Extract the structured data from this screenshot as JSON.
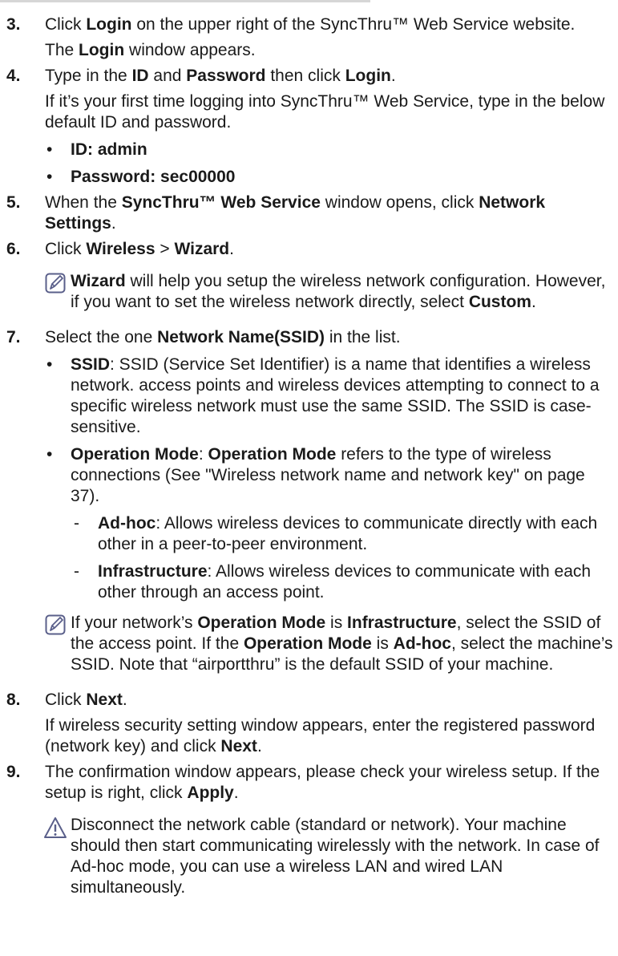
{
  "steps": [
    {
      "num": "3.",
      "t1": "Click ",
      "b1": "Login",
      "t2": " on the upper right of the SyncThru™ Web Service website.",
      "sub": {
        "b": "Login",
        "t": " window appears.",
        "pre": "The "
      }
    },
    {
      "num": "4.",
      "t1": "Type in the ",
      "b1": "ID",
      "t2": " and ",
      "b2": "Password",
      "t3": " then click ",
      "b3": "Login",
      "t4": ".",
      "p": "If it’s your first time logging into SyncThru™ Web Service, type in the below default ID and password.",
      "bullets": [
        "ID:  admin",
        "Password:  sec00000"
      ]
    },
    {
      "num": "5.",
      "t1": "When the ",
      "b1": "SyncThru™ Web Service",
      "t2": " window opens, click ",
      "b2": "Network Settings",
      "t3": "."
    },
    {
      "num": "6.",
      "t1": "Click ",
      "b1": "Wireless",
      "t2": " > ",
      "b2": "Wizard",
      "t3": ".",
      "note": {
        "b1": "Wizard",
        "t1": " will help you setup the wireless network configuration. However, if you want to set the wireless network directly, select ",
        "b2": "Custom",
        "t2": "."
      }
    },
    {
      "num": "7.",
      "t1": "Select the one ",
      "b1": "Network Name(SSID)",
      "t2": " in the list.",
      "ssid": {
        "b": "SSID",
        "t": ": SSID (Service Set Identifier) is a name that identifies a wireless network. access points and wireless devices attempting to connect to a specific wireless network must use the same SSID. The SSID is case-sensitive."
      },
      "opmode": {
        "b1": "Operation Mode",
        "t1": ": ",
        "b2": "Operation Mode",
        "t2": " refers to the type of wireless connections (See \"Wireless network name and network key\" on page 37)."
      },
      "adhoc": {
        "b": "Ad-hoc",
        "t": ": Allows wireless devices to communicate directly with each other in a peer-to-peer environment."
      },
      "infra": {
        "b": "Infrastructure",
        "t": ": Allows wireless devices to communicate with each other through an access point."
      },
      "note": {
        "t1": "If your network’s ",
        "b1": "Operation Mode",
        "t2": " is ",
        "b2": "Infrastructure",
        "t3": ", select the SSID of the access point. If the ",
        "b3": "Operation Mode",
        "t4": " is ",
        "b4": "Ad-hoc",
        "t5": ", select the machine’s SSID. Note that “airportthru” is the default SSID of your machine."
      }
    },
    {
      "num": "8.",
      "t1": "Click ",
      "b1": "Next",
      "t2": ".",
      "p1": "If wireless security setting window appears, enter the registered password (network key) and click ",
      "pb": "Next",
      "p2": "."
    },
    {
      "num": "9.",
      "t1": "The confirmation window appears, please check your wireless setup. If the setup is right, click ",
      "b1": "Apply",
      "t2": ".",
      "warn": "Disconnect the network cable (standard or network). Your machine should then start communicating wirelessly with the network. In case of Ad-hoc mode, you can use a wireless LAN and wired LAN simultaneously."
    }
  ],
  "bullet_glyph": "•",
  "dash_glyph": "-"
}
